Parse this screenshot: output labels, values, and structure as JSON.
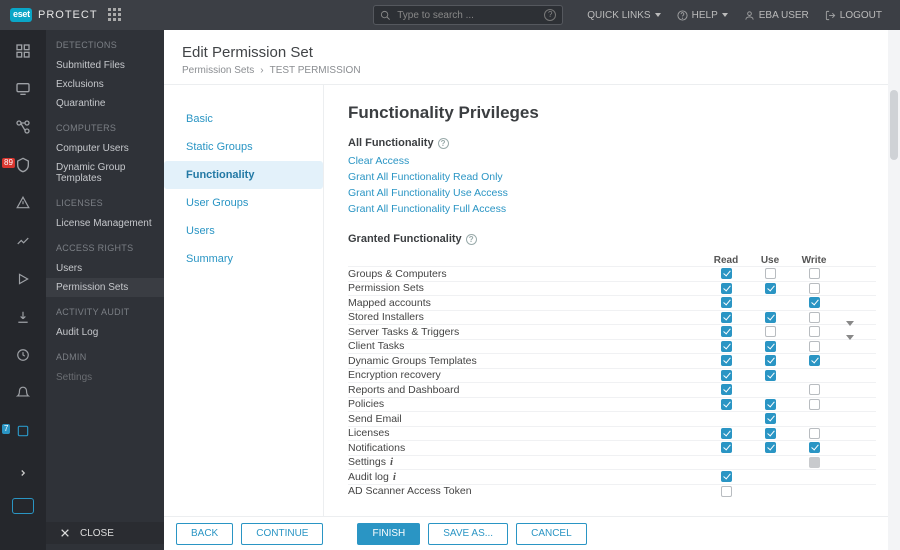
{
  "header": {
    "brand_text": "PROTECT",
    "search_placeholder": "Type to search ...",
    "quick_links": "QUICK LINKS",
    "help": "HELP",
    "user": "EBA USER",
    "logout": "LOGOUT"
  },
  "rail": {
    "badges": {
      "shield": "89",
      "blue": "7"
    }
  },
  "nav2": {
    "groups": [
      {
        "title": "DETECTIONS",
        "items": [
          "Submitted Files",
          "Exclusions",
          "Quarantine"
        ]
      },
      {
        "title": "COMPUTERS",
        "items": [
          "Computer Users",
          "Dynamic Group Templates"
        ]
      },
      {
        "title": "LICENSES",
        "items": [
          "License Management"
        ]
      },
      {
        "title": "ACCESS RIGHTS",
        "items": [
          "Users",
          "Permission Sets"
        ]
      },
      {
        "title": "ACTIVITY AUDIT",
        "items": [
          "Audit Log"
        ]
      },
      {
        "title": "ADMIN",
        "items": [
          "Settings"
        ]
      }
    ],
    "close": "CLOSE"
  },
  "main": {
    "title": "Edit Permission Set",
    "breadcrumb": {
      "root": "Permission Sets",
      "leaf": "TEST PERMISSION"
    },
    "leftmenu": [
      "Basic",
      "Static Groups",
      "Functionality",
      "User Groups",
      "Users",
      "Summary"
    ],
    "h1": "Functionality Privileges",
    "all_func": "All Functionality",
    "links": [
      "Clear Access",
      "Grant All Functionality Read Only",
      "Grant All Functionality Use Access",
      "Grant All Functionality Full Access"
    ],
    "granted_func": "Granted Functionality",
    "cols": {
      "read": "Read",
      "use": "Use",
      "write": "Write"
    },
    "rows": [
      {
        "name": "Groups & Computers",
        "read": true,
        "use": false,
        "write": false
      },
      {
        "name": "Permission Sets",
        "read": true,
        "use": true,
        "write": false
      },
      {
        "name": "Mapped accounts",
        "read": true,
        "use": null,
        "write": true
      },
      {
        "name": "Stored Installers",
        "read": true,
        "use": true,
        "write": false
      },
      {
        "name": "Server Tasks & Triggers",
        "read": true,
        "use": false,
        "write": false,
        "expand": true
      },
      {
        "name": "Client Tasks",
        "read": true,
        "use": true,
        "write": false,
        "expand": true
      },
      {
        "name": "Dynamic Groups Templates",
        "read": true,
        "use": true,
        "write": true
      },
      {
        "name": "Encryption recovery",
        "read": true,
        "use": true,
        "write": null
      },
      {
        "name": "Reports and Dashboard",
        "read": true,
        "use": null,
        "write": false
      },
      {
        "name": "Policies",
        "read": true,
        "use": true,
        "write": false
      },
      {
        "name": "Send Email",
        "read": null,
        "use": true,
        "write": null
      },
      {
        "name": "Licenses",
        "read": true,
        "use": true,
        "write": false
      },
      {
        "name": "Notifications",
        "read": true,
        "use": true,
        "write": true
      },
      {
        "name": "Settings",
        "read": null,
        "use": null,
        "write": "grey",
        "info": true
      },
      {
        "name": "Audit log",
        "read": true,
        "use": null,
        "write": null,
        "info": true
      },
      {
        "name": "AD Scanner Access Token",
        "read": false,
        "use": null,
        "write": null
      }
    ],
    "footer": {
      "back": "BACK",
      "continue": "CONTINUE",
      "finish": "FINISH",
      "save_as": "SAVE AS...",
      "cancel": "CANCEL"
    }
  }
}
